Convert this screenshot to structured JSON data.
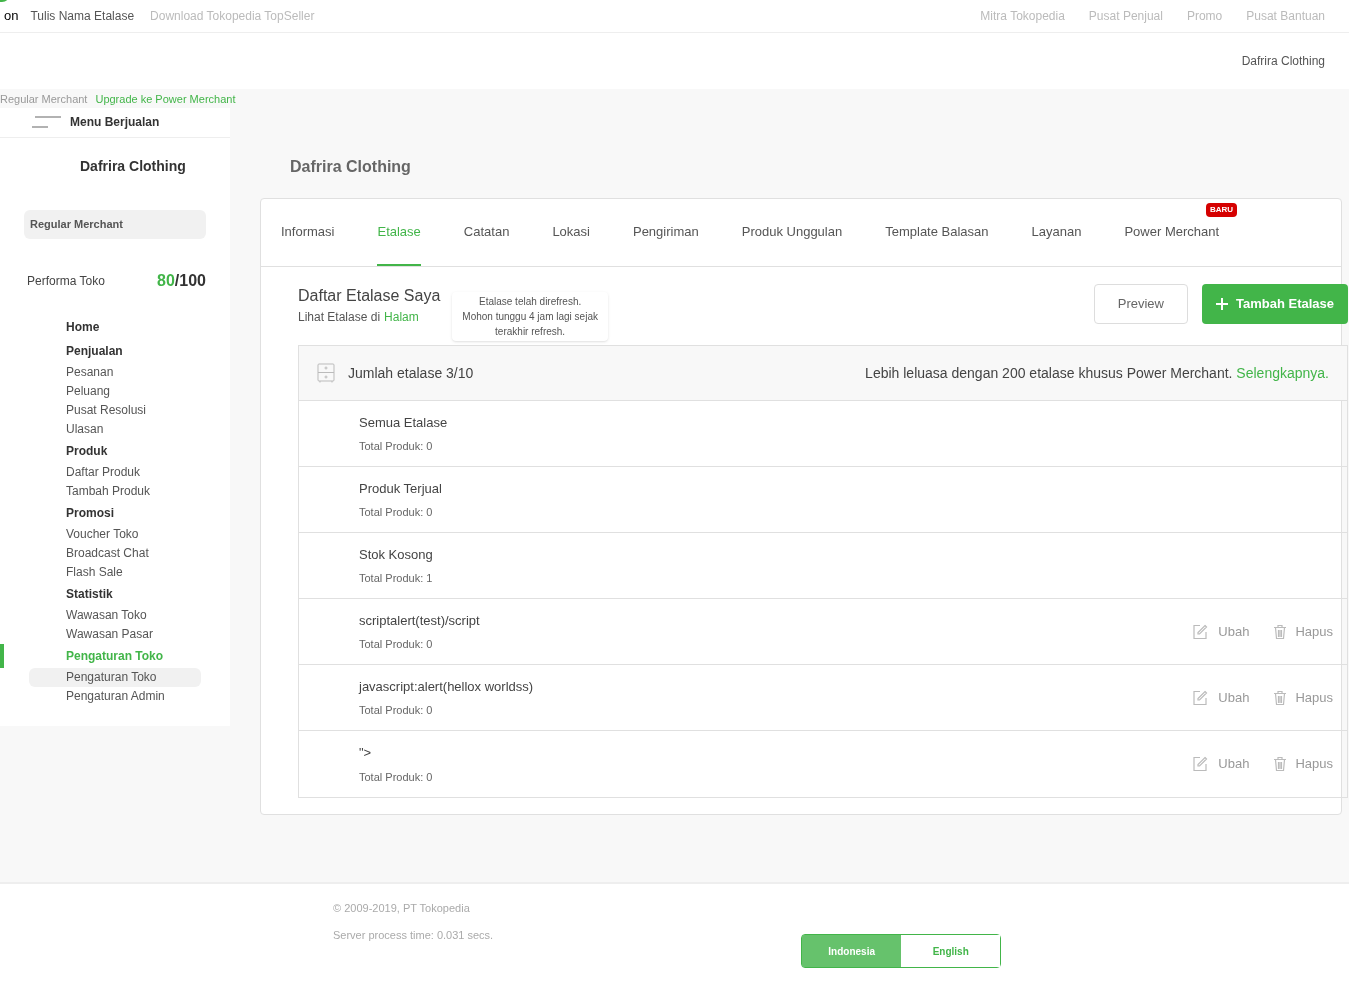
{
  "topbar": {
    "fragment": "on",
    "broken_label": "Tulis Nama Etalase",
    "download_link": "Download Tokopedia TopSeller",
    "links": [
      "Mitra Tokopedia",
      "Pusat Penjual",
      "Promo",
      "Pusat Bantuan"
    ]
  },
  "header": {
    "shop_name": "Dafrira Clothing"
  },
  "merchant_bar": {
    "status": "Regular Merchant",
    "upgrade_link": "Upgrade ke Power Merchant"
  },
  "sidebar": {
    "menu_title": "Menu Berjualan",
    "shop_name": "Dafrira Clothing",
    "badge": "Regular Merchant",
    "performance_label": "Performa Toko",
    "score": "80",
    "score_max": "/100",
    "sections": [
      {
        "label": "Home",
        "selected": false
      },
      {
        "label": "Penjualan",
        "selected": false,
        "children": [
          {
            "label": "Pesanan",
            "selected": false
          },
          {
            "label": "Peluang",
            "selected": false
          },
          {
            "label": "Pusat Resolusi",
            "selected": false
          },
          {
            "label": "Ulasan",
            "selected": false
          }
        ]
      },
      {
        "label": "Produk",
        "selected": false,
        "children": [
          {
            "label": "Daftar Produk",
            "selected": false
          },
          {
            "label": "Tambah Produk",
            "selected": false
          }
        ]
      },
      {
        "label": "Promosi",
        "selected": false,
        "children": [
          {
            "label": "Voucher Toko",
            "selected": false
          },
          {
            "label": "Broadcast Chat",
            "selected": false
          },
          {
            "label": "Flash Sale",
            "selected": false
          }
        ]
      },
      {
        "label": "Statistik",
        "selected": false,
        "children": [
          {
            "label": "Wawasan Toko",
            "selected": false
          },
          {
            "label": "Wawasan Pasar",
            "selected": false
          }
        ]
      },
      {
        "label": "Pengaturan Toko",
        "selected": true,
        "children": [
          {
            "label": "Pengaturan Toko",
            "selected": true
          },
          {
            "label": "Pengaturan Admin",
            "selected": false
          }
        ]
      }
    ]
  },
  "page_title": "Dafrira Clothing",
  "tabs": [
    {
      "label": "Informasi",
      "selected": false
    },
    {
      "label": "Etalase",
      "selected": true
    },
    {
      "label": "Catatan",
      "selected": false
    },
    {
      "label": "Lokasi",
      "selected": false
    },
    {
      "label": "Pengiriman",
      "selected": false
    },
    {
      "label": "Produk Unggulan",
      "selected": false
    },
    {
      "label": "Template Balasan",
      "selected": false
    },
    {
      "label": "Layanan",
      "selected": false
    },
    {
      "label": "Power Merchant",
      "selected": false,
      "badge": "BARU"
    }
  ],
  "etalase": {
    "title": "Daftar Etalase Saya",
    "subtitle": "Lihat Etalase di",
    "subtitle_link": "Halam",
    "tooltip": [
      "Etalase telah direfresh.",
      "Mohon tunggu 4 jam lagi sejak",
      "terakhir refresh."
    ],
    "preview_button": "Preview",
    "add_button": "Tambah Etalase",
    "count_label": "Jumlah etalase 3/10",
    "promo_text": "Lebih leluasa dengan 200 etalase khusus Power Merchant.",
    "promo_link": "Selengkapnya.",
    "rows": [
      {
        "kind": "default",
        "name": "Semua Etalase",
        "count": "Total Produk: 0"
      },
      {
        "kind": "default",
        "name": "Produk Terjual",
        "count": "Total Produk: 0"
      },
      {
        "kind": "default",
        "name": "Stok Kosong",
        "count": "Total Produk: 1"
      },
      {
        "kind": "custom",
        "name": "scriptalert(test)/script",
        "count": "Total Produk: 0",
        "edit": "Ubah",
        "delete": "Hapus"
      },
      {
        "kind": "custom",
        "name": "javascript:alert(hellox worldss)",
        "count": "Total Produk: 0",
        "edit": "Ubah",
        "delete": "Hapus"
      },
      {
        "kind": "custom",
        "name": "\">",
        "count": "Total Produk: 0",
        "edit": "Ubah",
        "delete": "Hapus"
      }
    ]
  },
  "footer": {
    "copyright": "© 2009-2019, PT Tokopedia",
    "server_time": "Server process time: 0.031 secs.",
    "languages": [
      {
        "label": "Indonesia",
        "selected": true
      },
      {
        "label": "English",
        "selected": false
      }
    ]
  }
}
